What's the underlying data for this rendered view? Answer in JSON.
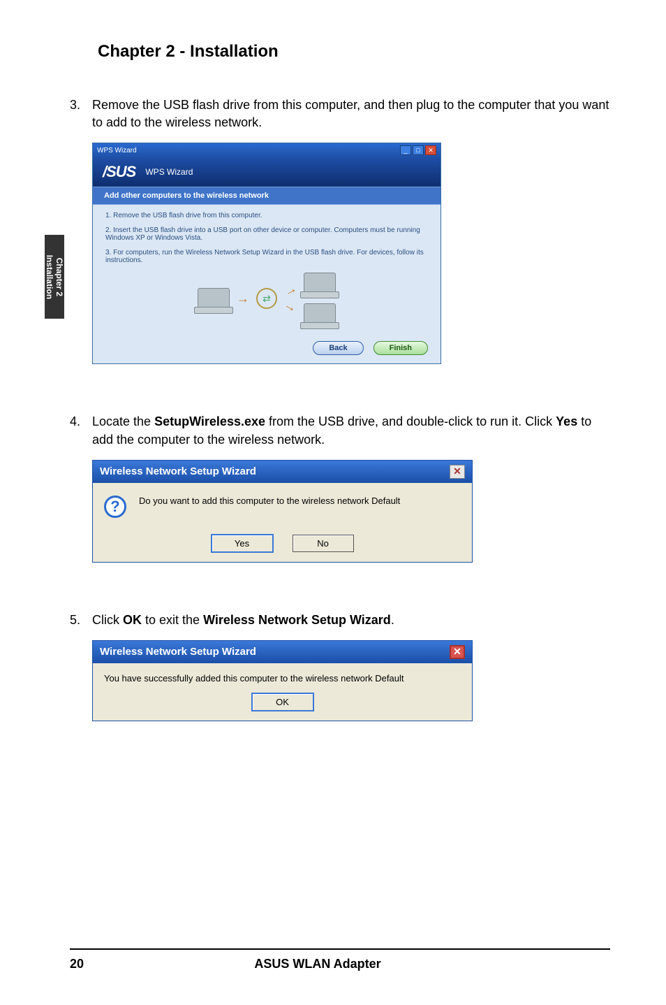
{
  "chapter_title": "Chapter 2 - Installation",
  "side_tab": {
    "line1": "Chapter 2",
    "line2": "Installation"
  },
  "steps": {
    "s3": {
      "num": "3.",
      "text": "Remove the USB flash drive from this computer, and then plug to the computer that you want to add to the wireless network."
    },
    "s4": {
      "num": "4.",
      "prefix": "Locate the ",
      "bold1": "SetupWireless.exe",
      "mid": " from the USB drive, and double-click to run it. Click ",
      "bold2": "Yes",
      "suffix": " to add the computer to the wireless network."
    },
    "s5": {
      "num": "5.",
      "prefix": "Click ",
      "bold1": "OK",
      "mid": " to exit the ",
      "bold2": "Wireless Network Setup Wizard",
      "suffix": "."
    }
  },
  "wps": {
    "title": "WPS Wizard",
    "brand": "/SUS",
    "brand_sub": "WPS Wizard",
    "banner": "Add other computers to the wireless network",
    "line1": "1. Remove the USB flash drive from this computer.",
    "line2": "2. Insert the USB flash drive into a USB port on other device or computer. Computers must be running Windows XP or Windows Vista.",
    "line3": "3. For computers, run the Wireless Network Setup Wizard in the USB flash drive. For devices, follow its instructions.",
    "back": "Back",
    "finish": "Finish",
    "usb_glyph": "⇄"
  },
  "dlg1": {
    "title": "Wireless Network Setup Wizard",
    "msg": "Do you want to add this computer to the wireless network Default",
    "yes": "Yes",
    "no": "No",
    "close": "✕",
    "q": "?"
  },
  "dlg2": {
    "title": "Wireless Network Setup Wizard",
    "msg": "You have successfully added this computer to the wireless network Default",
    "ok": "OK",
    "close": "✕"
  },
  "footer": {
    "page": "20",
    "product": "ASUS WLAN Adapter"
  }
}
